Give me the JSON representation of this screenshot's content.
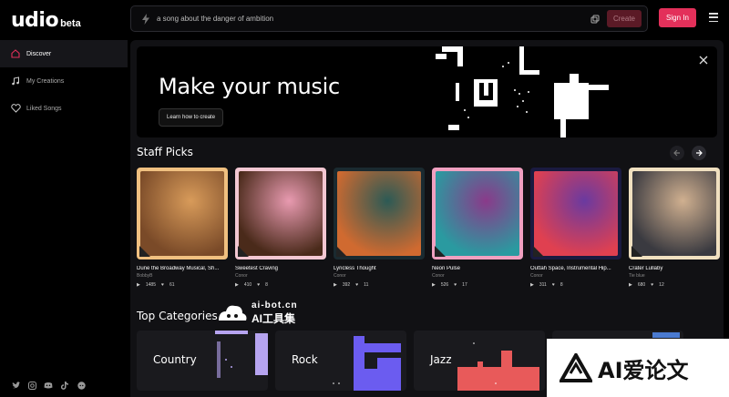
{
  "app": {
    "brand": "udio",
    "badge": "beta"
  },
  "search": {
    "value": "a song about the danger of ambition",
    "create_label": "Create"
  },
  "header": {
    "signin_label": "Sign In"
  },
  "sidebar": {
    "items": [
      {
        "label": "Discover",
        "icon": "home-icon",
        "active": true
      },
      {
        "label": "My Creations",
        "icon": "music-note-icon",
        "active": false
      },
      {
        "label": "Liked Songs",
        "icon": "heart-icon",
        "active": false
      }
    ],
    "socials": [
      "twitter-icon",
      "instagram-icon",
      "discord-icon",
      "tiktok-icon",
      "reddit-icon"
    ]
  },
  "hero": {
    "title": "Make your music",
    "cta_label": "Learn how to create"
  },
  "staff_picks": {
    "title": "Staff Picks",
    "items": [
      {
        "title": "Dune the Broadway Musical, Sh...",
        "artist": "BobbyB",
        "plays": "1485",
        "likes": "61",
        "cover": [
          "#d89b5a",
          "#7a4a28",
          "#f0c080"
        ]
      },
      {
        "title": "Sweetest Craving",
        "artist": "Conor",
        "plays": "410",
        "likes": "8",
        "cover": [
          "#e89ab0",
          "#4a2a1a",
          "#f3c7d2"
        ]
      },
      {
        "title": "Lyricless Thought",
        "artist": "Conor",
        "plays": "392",
        "likes": "11",
        "cover": [
          "#2c5a55",
          "#d06a30",
          "#1a2a30"
        ]
      },
      {
        "title": "Neon Pulse",
        "artist": "Conor",
        "plays": "526",
        "likes": "17",
        "cover": [
          "#8a3a8a",
          "#2a9aa0",
          "#f0a0c0"
        ]
      },
      {
        "title": "Outtah Space, Instrumental Hip...",
        "artist": "Conor",
        "plays": "311",
        "likes": "8",
        "cover": [
          "#6a3aa0",
          "#e04050",
          "#1a1a40"
        ]
      },
      {
        "title": "Crater Lullaby",
        "artist": "Tie blue",
        "plays": "680",
        "likes": "12",
        "cover": [
          "#d0b090",
          "#3a3a40",
          "#f0e0c0"
        ]
      }
    ]
  },
  "categories": {
    "title": "Top Categories",
    "items": [
      {
        "label": "Country",
        "accent": "#b6a4f0"
      },
      {
        "label": "Rock",
        "accent": "#6b5cf0"
      },
      {
        "label": "Jazz",
        "accent": "#e85a5a"
      },
      {
        "label": "",
        "accent": "#4a7ad0"
      }
    ]
  },
  "watermarks": {
    "top_site": "ai-bot.cn",
    "top_label": "AI工具集",
    "corner_label": "AI爱论文"
  }
}
